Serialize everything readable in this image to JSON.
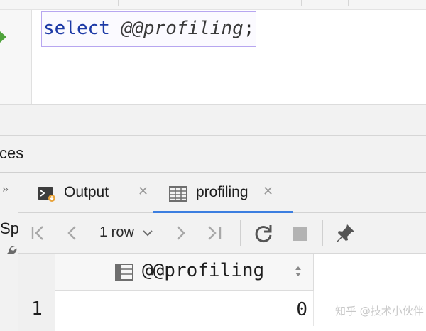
{
  "editor": {
    "keyword": "select",
    "variable": "@@profiling",
    "terminator": ";"
  },
  "services_panel": {
    "title_fragment": "ces",
    "left_label_fragment": "Sp",
    "collapse_glyph": "››"
  },
  "tabs": [
    {
      "label": "Output",
      "icon": "console-output-icon",
      "close": "✕",
      "active": false
    },
    {
      "label": "profiling",
      "icon": "table-grid-icon",
      "close": "✕",
      "active": true
    }
  ],
  "toolbar": {
    "first_page": "first-page-icon",
    "prev_page": "previous-page-icon",
    "row_count": "1 row",
    "next_page": "next-page-icon",
    "last_page": "last-page-icon",
    "refresh": "refresh-icon",
    "stop": "stop-icon",
    "pin": "pin-tab-icon"
  },
  "result": {
    "columns": [
      "@@profiling"
    ],
    "rows": [
      {
        "row_number": "1",
        "values": [
          "0"
        ]
      }
    ]
  },
  "watermark": "知乎 @技术小伙伴",
  "colors": {
    "keyword": "#1d3aa6",
    "selection_border": "#b7a6f0",
    "run_marker": "#4fa33b",
    "active_tab_underline": "#3c7ee0"
  }
}
